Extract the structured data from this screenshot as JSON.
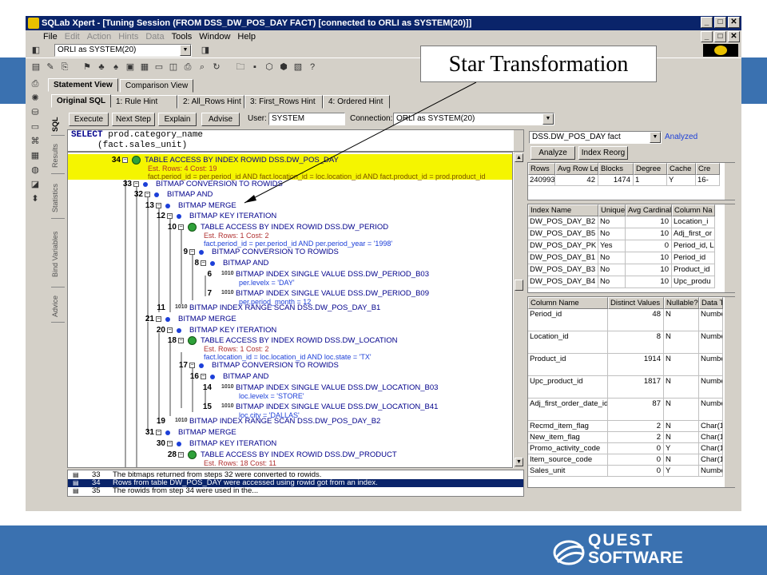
{
  "window": {
    "title": "SQLab Xpert - [Tuning Session (FROM DSS_DW_POS_DAY FACT) [connected to ORLI as SYSTEM(20)]]",
    "controls": [
      "_",
      "̅",
      "X"
    ]
  },
  "menu": [
    "File",
    "Edit",
    "Action",
    "Hints",
    "Data",
    "Tools",
    "Window",
    "Help"
  ],
  "menu_disabled": [
    "Edit",
    "Action",
    "Hints",
    "Data"
  ],
  "connection_combo": "ORLI as SYSTEM(20)",
  "callout": "Star Transformation",
  "views": [
    "Statement View",
    "Comparison View"
  ],
  "hint_tabs": [
    "Original SQL",
    "1: Rule Hint",
    "2: All_Rows Hint",
    "3: First_Rows Hint",
    "4: Ordered Hint"
  ],
  "side_tabs": [
    "SQL",
    "Results",
    "Statistics",
    "Bind Variables",
    "Advice"
  ],
  "actions": {
    "execute": "Execute",
    "next_step": "Next Step",
    "explain": "Explain",
    "advise": "Advise"
  },
  "user": {
    "label": "User:",
    "value": "SYSTEM"
  },
  "connection": {
    "label": "Connection:",
    "value": "ORLI as SYSTEM(20)"
  },
  "sql_text": {
    "keyword": "SELECT",
    "line1": "prod.category_name",
    "line2": "     (fact.sales_unit)"
  },
  "plan": [
    {
      "id": "34",
      "op": "TABLE ACCESS BY INDEX ROWID DSS.DW_POS_DAY",
      "cost": "Est. Rows: 4  Cost: 19",
      "filter": "fact.period_id = per.period_id AND fact.location_id = loc.location_id AND fact.product_id = prod.product_id"
    },
    {
      "id": "33",
      "op": "BITMAP CONVERSION TO ROWIDS"
    },
    {
      "id": "32",
      "op": "BITMAP AND"
    },
    {
      "id": "13",
      "op": "BITMAP MERGE"
    },
    {
      "id": "12",
      "op": "BITMAP KEY ITERATION"
    },
    {
      "id": "10",
      "op": "TABLE ACCESS BY INDEX ROWID DSS.DW_PERIOD",
      "cost": "Est. Rows: 1  Cost: 2",
      "filter": "fact.period_id = per.period_id AND per.period_year = '1998'"
    },
    {
      "id": "9",
      "op": "BITMAP CONVERSION TO ROWIDS"
    },
    {
      "id": "8",
      "op": "BITMAP AND"
    },
    {
      "id": "6",
      "op": "BITMAP INDEX SINGLE VALUE DSS.DW_PERIOD_B03",
      "filter": "per.levelx = 'DAY'"
    },
    {
      "id": "7",
      "op": "BITMAP INDEX SINGLE VALUE DSS.DW_PERIOD_B09",
      "filter": "per.period_month = 12"
    },
    {
      "id": "11",
      "op": "BITMAP INDEX RANGE SCAN DSS.DW_POS_DAY_B1"
    },
    {
      "id": "21",
      "op": "BITMAP MERGE"
    },
    {
      "id": "20",
      "op": "BITMAP KEY ITERATION"
    },
    {
      "id": "18",
      "op": "TABLE ACCESS BY INDEX ROWID DSS.DW_LOCATION",
      "cost": "Est. Rows: 1  Cost: 2",
      "filter": "fact.location_id = loc.location_id AND loc.state = 'TX'"
    },
    {
      "id": "17",
      "op": "BITMAP CONVERSION TO ROWIDS"
    },
    {
      "id": "16",
      "op": "BITMAP AND"
    },
    {
      "id": "14",
      "op": "BITMAP INDEX SINGLE VALUE DSS.DW_LOCATION_B03",
      "filter": "loc.levelx = 'STORE'"
    },
    {
      "id": "15",
      "op": "BITMAP INDEX SINGLE VALUE DSS.DW_LOCATION_B41",
      "filter": "loc.city = 'DALLAS'"
    },
    {
      "id": "19",
      "op": "BITMAP INDEX RANGE SCAN DSS.DW_POS_DAY_B2"
    },
    {
      "id": "31",
      "op": "BITMAP MERGE"
    },
    {
      "id": "30",
      "op": "BITMAP KEY ITERATION"
    },
    {
      "id": "28",
      "op": "TABLE ACCESS BY INDEX ROWID DSS.DW_PRODUCT",
      "cost": "Est. Rows: 18  Cost: 11"
    }
  ],
  "messages": [
    {
      "id": "33",
      "text": "The bitmaps returned from steps 32 were converted to rowids."
    },
    {
      "id": "34",
      "text": "Rows from table DW_POS_DAY were accessed using rowid got from an index."
    },
    {
      "id": "35",
      "text": "The rowids from step 34 were used in the..."
    }
  ],
  "object_panel": {
    "table": "DSS.DW_POS_DAY fact",
    "status": "Analyzed",
    "analyze": "Analyze",
    "reorg": "Index Reorg",
    "stats_headers": [
      "Rows",
      "Avg Row Len",
      "Blocks",
      "Degree",
      "Cache",
      "Cre"
    ],
    "stats_row": [
      "240993",
      "42",
      "1474",
      "1",
      "Y",
      "16-"
    ],
    "index_headers": [
      "Index Name",
      "Unique",
      "Avg Cardinality",
      "Column Na"
    ],
    "indexes": [
      [
        "DW_POS_DAY_B2",
        "No",
        "10",
        "Location_i"
      ],
      [
        "DW_POS_DAY_B5",
        "No",
        "10",
        "Adj_first_or"
      ],
      [
        "DW_POS_DAY_PK",
        "Yes",
        "0",
        "Period_id, L"
      ],
      [
        "DW_POS_DAY_B1",
        "No",
        "10",
        "Period_id"
      ],
      [
        "DW_POS_DAY_B3",
        "No",
        "10",
        "Product_id"
      ],
      [
        "DW_POS_DAY_B4",
        "No",
        "10",
        "Upc_produ"
      ]
    ],
    "column_headers": [
      "Column Name",
      "Distinct Values",
      "Nullable?",
      "Data T"
    ],
    "columns": [
      [
        "Period_id",
        "48",
        "N",
        "Numbe"
      ],
      [
        "Location_id",
        "8",
        "N",
        "Numbe"
      ],
      [
        "Product_id",
        "1914",
        "N",
        "Numbe"
      ],
      [
        "Upc_product_id",
        "1817",
        "N",
        "Numbe"
      ],
      [
        "Adj_first_order_date_id",
        "87",
        "N",
        "Numbe"
      ],
      [
        "Recmd_item_flag",
        "2",
        "N",
        "Char(1"
      ],
      [
        "New_item_flag",
        "2",
        "N",
        "Char(1"
      ],
      [
        "Promo_activity_code",
        "0",
        "Y",
        "Char(1"
      ],
      [
        "Item_source_code",
        "0",
        "N",
        "Char(1"
      ],
      [
        "Sales_unit",
        "0",
        "Y",
        "Numbe"
      ]
    ]
  },
  "logo": {
    "line1": "QUEST",
    "line2": "SOFTWARE"
  },
  "colors": {
    "band": "#3a71b0",
    "title": "#0a246a",
    "highlight": "#f5f500",
    "node": "#00008b",
    "cost": "#b03030",
    "filter": "#1c3fd8",
    "ok_icon": "#2fa13a"
  }
}
